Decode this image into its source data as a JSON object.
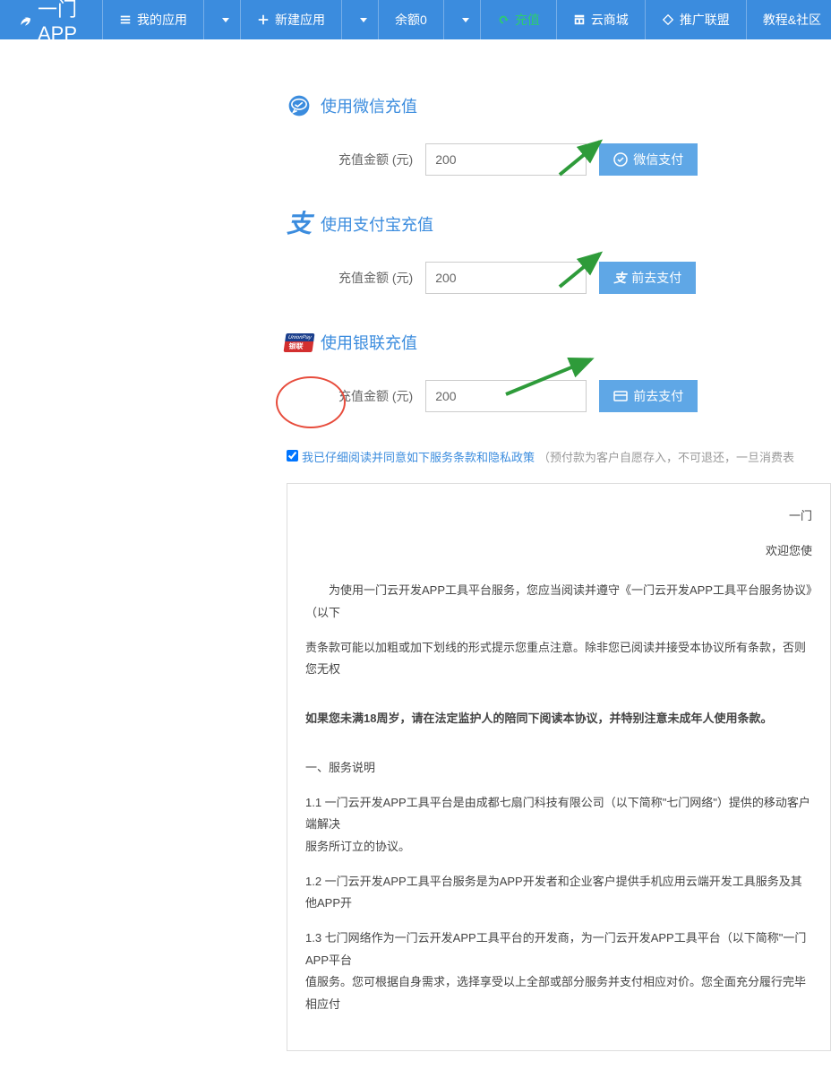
{
  "navbar": {
    "brand": "一门APP",
    "items": [
      {
        "label": "我的应用",
        "icon": "list"
      },
      {
        "label": "新建应用",
        "icon": "plus"
      },
      {
        "label": "余额0",
        "icon": ""
      },
      {
        "label": "充值",
        "icon": "refresh",
        "active": true
      },
      {
        "label": "云商城",
        "icon": "store"
      },
      {
        "label": "推广联盟",
        "icon": "diamond"
      },
      {
        "label": "教程&社区",
        "icon": ""
      }
    ]
  },
  "wechat": {
    "heading": "使用微信充值",
    "label": "充值金额 (元)",
    "value": "200",
    "button": "微信支付"
  },
  "alipay": {
    "heading": "使用支付宝充值",
    "label": "充值金额 (元)",
    "value": "200",
    "button": "前去支付"
  },
  "unionpay": {
    "heading": "使用银联充值",
    "label": "充值金额 (元)",
    "value": "200",
    "button": "前去支付",
    "badge_top": "UnionPay",
    "badge_bottom": "银联"
  },
  "agree": {
    "checked": true,
    "link_text": "我已仔细阅读并同意如下服务条款和隐私政策",
    "note": "（预付款为客户自愿存入，不可退还，一旦消费表"
  },
  "terms": {
    "title_tail": "一门",
    "welcome_tail": "欢迎您使",
    "para1": "为使用一门云开发APP工具平台服务，您应当阅读并遵守《一门云开发APP工具平台服务协议》（以下",
    "para2": "责条款可能以加粗或加下划线的形式提示您重点注意。除非您已阅读并接受本协议所有条款，否则您无权",
    "minor": "如果您未满18周岁，请在法定监护人的陪同下阅读本协议，并特别注意未成年人使用条款。",
    "sec1_head": "一、服务说明",
    "sec1_1": "1.1 一门云开发APP工具平台是由成都七扇门科技有限公司（以下简称\"七门网络\"）提供的移动客户端解决",
    "sec1_1b": "服务所订立的协议。",
    "sec1_2": "1.2 一门云开发APP工具平台服务是为APP开发者和企业客户提供手机应用云端开发工具服务及其他APP开",
    "sec1_3": "1.3 七门网络作为一门云开发APP工具平台的开发商，为一门云开发APP工具平台（以下简称\"一门APP平台",
    "sec1_3b": "值服务。您可根据自身需求，选择享受以上全部或部分服务并支付相应对价。您全面充分履行完毕相应付"
  }
}
